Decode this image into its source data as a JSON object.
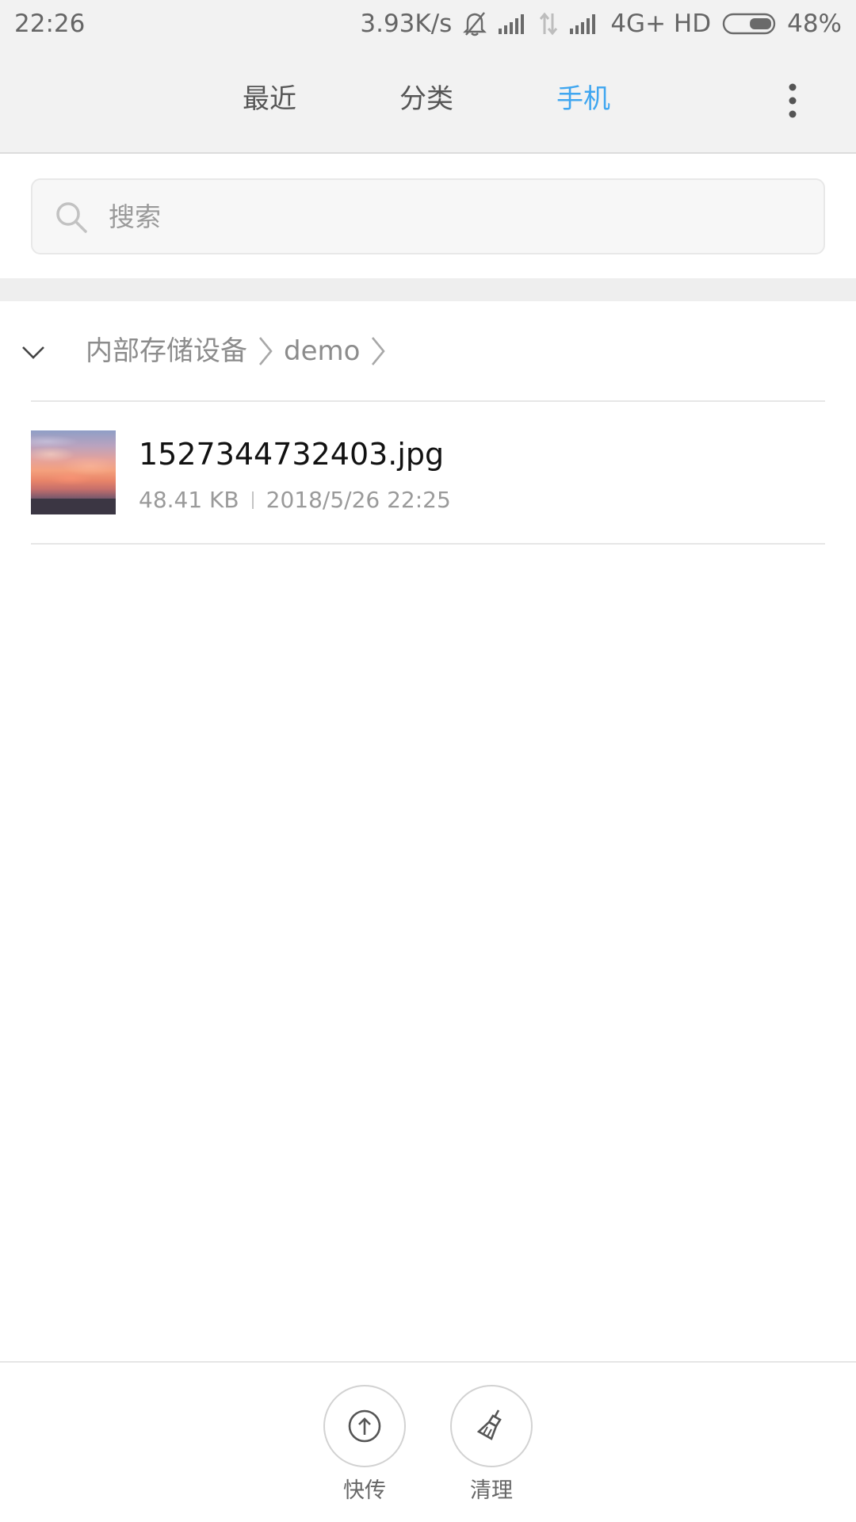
{
  "status_bar": {
    "time": "22:26",
    "network_speed": "3.93K/s",
    "network_type": "4G+ HD",
    "battery_percent": "48%",
    "battery_level": 0.48,
    "icons": [
      "mute-bell-icon",
      "signal-icon",
      "data-arrows-icon",
      "signal-icon",
      "battery-icon"
    ]
  },
  "tabs": [
    {
      "label": "最近",
      "active": false
    },
    {
      "label": "分类",
      "active": false
    },
    {
      "label": "手机",
      "active": true
    }
  ],
  "search": {
    "placeholder": "搜索",
    "value": ""
  },
  "breadcrumb": {
    "items": [
      "内部存储设备",
      "demo"
    ]
  },
  "files": [
    {
      "name": "1527344732403.jpg",
      "size": "48.41 KB",
      "modified": "2018/5/26 22:25",
      "thumbnail": "sunset-photo"
    }
  ],
  "bottom_actions": [
    {
      "label": "快传",
      "icon": "upload-circle-icon"
    },
    {
      "label": "清理",
      "icon": "broom-icon"
    }
  ],
  "colors": {
    "accent": "#3fa6f0",
    "tab_text": "#555555",
    "secondary_text": "#9a9a9a"
  }
}
